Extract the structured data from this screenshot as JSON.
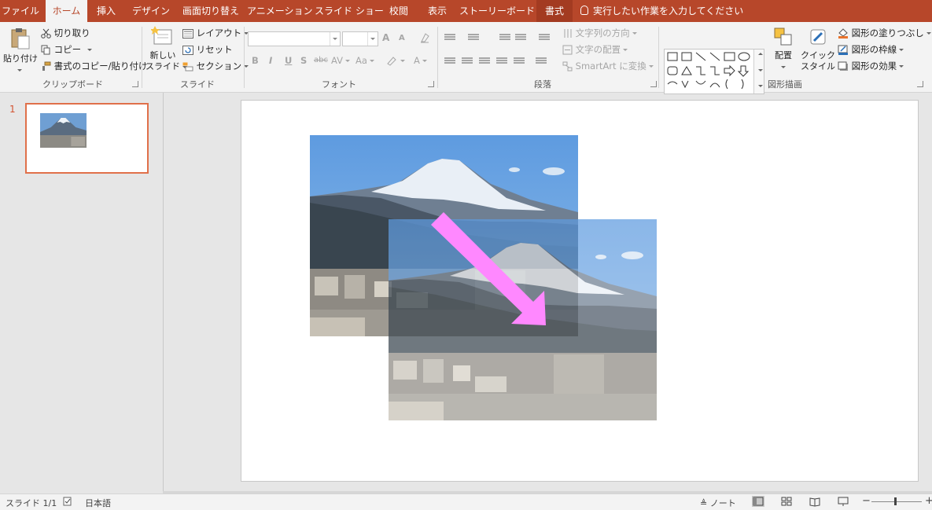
{
  "tabs": [
    {
      "label": "ファイル",
      "active": false
    },
    {
      "label": "ホーム",
      "active": true
    },
    {
      "label": "挿入",
      "active": false
    },
    {
      "label": "デザイン",
      "active": false
    },
    {
      "label": "画面切り替え",
      "active": false
    },
    {
      "label": "アニメーション",
      "active": false
    },
    {
      "label": "スライド ショー",
      "active": false
    },
    {
      "label": "校閲",
      "active": false
    },
    {
      "label": "表示",
      "active": false
    },
    {
      "label": "ストーリーボード",
      "active": false
    },
    {
      "label": "書式",
      "active": false,
      "contextual": true
    }
  ],
  "tell_me": "実行したい作業を入力してください",
  "ribbon": {
    "clipboard": {
      "paste": "貼り付け",
      "cut": "切り取り",
      "copy": "コピー",
      "format_painter": "書式のコピー/貼り付け",
      "label": "クリップボード"
    },
    "slides": {
      "new_slide_line1": "新しい",
      "new_slide_line2": "スライド",
      "layout": "レイアウト",
      "reset": "リセット",
      "section": "セクション",
      "label": "スライド"
    },
    "font": {
      "font_name": "",
      "font_size": "",
      "bold": "B",
      "italic": "I",
      "underline": "U",
      "shadow": "S",
      "strike": "abc",
      "spacing": "AV",
      "case": "Aa",
      "color": "A",
      "grow": "A",
      "shrink": "A",
      "label": "フォント"
    },
    "paragraph": {
      "text_direction": "文字列の方向",
      "align_text": "文字の配置",
      "smartart": "SmartArt に変換",
      "label": "段落"
    },
    "drawing": {
      "arrange": "配置",
      "quick_styles_line1": "クイック",
      "quick_styles_line2": "スタイル",
      "shape_fill": "図形の塗りつぶし",
      "shape_outline": "図形の枠線",
      "shape_effects": "図形の効果",
      "label": "図形描画"
    }
  },
  "thumbnails": [
    {
      "number": "1"
    }
  ],
  "status": {
    "slide": "スライド 1/1",
    "language": "日本語",
    "notes": "ノート"
  },
  "colors": {
    "accent": "#b7472a",
    "arrow": "#ff88ff",
    "selection": "#e0704a"
  }
}
